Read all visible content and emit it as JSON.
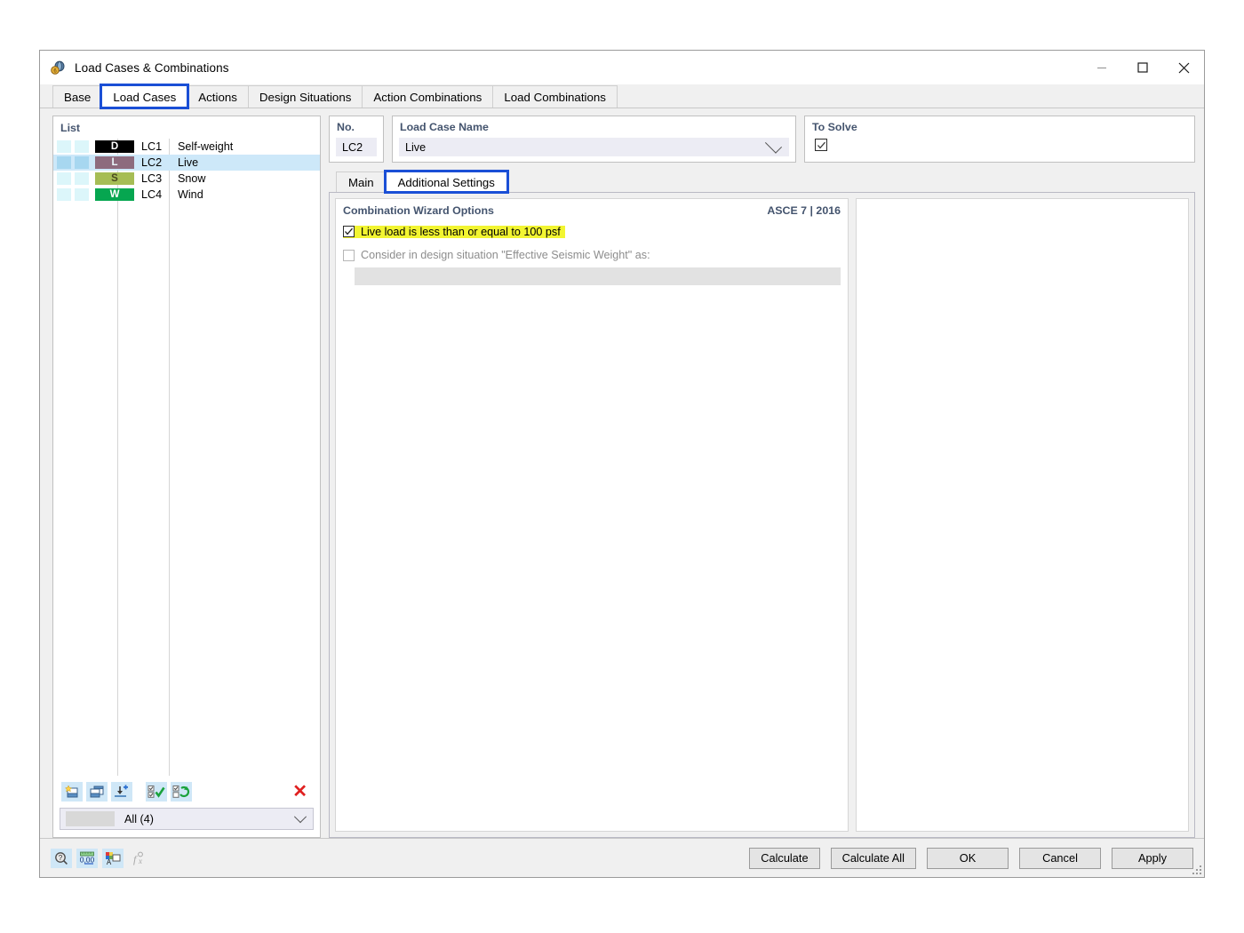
{
  "window": {
    "title": "Load Cases & Combinations",
    "icon": "load-case-icon",
    "minimize": "—",
    "maximize": "☐",
    "close": "✕"
  },
  "tabs": [
    {
      "label": "Base",
      "active": false,
      "highlighted": false
    },
    {
      "label": "Load Cases",
      "active": true,
      "highlighted": true
    },
    {
      "label": "Actions",
      "active": false,
      "highlighted": false
    },
    {
      "label": "Design Situations",
      "active": false,
      "highlighted": false
    },
    {
      "label": "Action Combinations",
      "active": false,
      "highlighted": false
    },
    {
      "label": "Load Combinations",
      "active": false,
      "highlighted": false
    }
  ],
  "list": {
    "header": "List",
    "rows": [
      {
        "badge": "D",
        "badge_color": "#000000",
        "badge_text_color": "#ffffff",
        "no": "LC1",
        "name": "Self-weight",
        "selected": false
      },
      {
        "badge": "L",
        "badge_color": "#8d6b7e",
        "badge_text_color": "#e9f6fb",
        "no": "LC2",
        "name": "Live",
        "selected": true
      },
      {
        "badge": "S",
        "badge_color": "#a6bd55",
        "badge_text_color": "#4a4a20",
        "no": "LC3",
        "name": "Snow",
        "selected": false
      },
      {
        "badge": "W",
        "badge_color": "#06a650",
        "badge_text_color": "#ffffff",
        "no": "LC4",
        "name": "Wind",
        "selected": false
      }
    ],
    "toolbar": [
      {
        "name": "new-load-case-icon",
        "title": "New"
      },
      {
        "name": "copy-load-case-icon",
        "title": "Copy"
      },
      {
        "name": "import-load-case-icon",
        "title": "Import"
      },
      {
        "name": "select-all-icon",
        "title": "Select All"
      },
      {
        "name": "invert-selection-icon",
        "title": "Invert Selection"
      }
    ],
    "delete_icon": "✕",
    "filter": "All (4)"
  },
  "fields": {
    "no_label": "No.",
    "no_value": "LC2",
    "name_label": "Load Case Name",
    "name_value": "Live",
    "to_solve_label": "To Solve",
    "to_solve_checked": true
  },
  "inner_tabs": [
    {
      "label": "Main",
      "active": false,
      "highlighted": false
    },
    {
      "label": "Additional Settings",
      "active": true,
      "highlighted": true
    }
  ],
  "combination_wizard": {
    "title": "Combination Wizard Options",
    "standard": "ASCE 7 | 2016",
    "option1_label": "Live load is less than or equal to 100 psf",
    "option1_checked": true,
    "option1_highlighted": true,
    "option2_label": "Consider in design situation \"Effective Seismic Weight\" as:",
    "option2_checked": false,
    "option2_enabled": false,
    "seismic_value": ""
  },
  "footer": {
    "icons": [
      {
        "name": "help-magnifier-icon",
        "enabled": true
      },
      {
        "name": "numeric-format-icon",
        "enabled": true
      },
      {
        "name": "font-color-icon",
        "enabled": true
      },
      {
        "name": "formula-icon",
        "enabled": false
      }
    ],
    "buttons": [
      {
        "label": "Calculate",
        "wide": false
      },
      {
        "label": "Calculate All",
        "wide": true
      },
      {
        "label": "OK",
        "wide": true
      },
      {
        "label": "Cancel",
        "wide": true
      },
      {
        "label": "Apply",
        "wide": true
      }
    ]
  },
  "colors": {
    "accent_blue": "#1a4fd6",
    "header_text": "#44546e",
    "selection": "#cde8f9",
    "highlight_yellow": "#f2f531",
    "field_bg": "#ececf4"
  }
}
